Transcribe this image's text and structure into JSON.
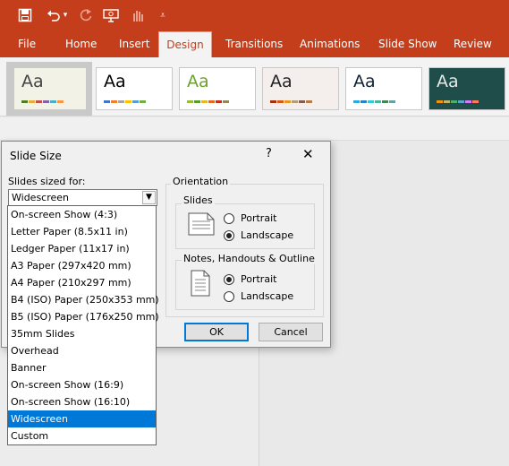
{
  "titlebar": {
    "icons": [
      "save-icon",
      "undo-icon",
      "undo-dropdown-icon",
      "redo-icon",
      "present-from-start-icon",
      "touch-mode-icon",
      "customize-qat-icon"
    ]
  },
  "ribbon_tabs": [
    "File",
    "Home",
    "Insert",
    "Design",
    "Transitions",
    "Animations",
    "Slide Show",
    "Review"
  ],
  "active_tab": "Design",
  "themes": [
    {
      "sample": "Aa",
      "bg": "#f2f2e6",
      "text": "#444",
      "stripe": [
        "#4f7a28",
        "#e3ad3d",
        "#c0504d",
        "#8064a2",
        "#4bacc6",
        "#f79646"
      ]
    },
    {
      "sample": "Aa",
      "bg": "#ffffff",
      "text": "#000",
      "stripe": [
        "#4472c4",
        "#ed7d31",
        "#a5a5a5",
        "#ffc000",
        "#5b9bd5",
        "#70ad47"
      ]
    },
    {
      "sample": "Aa",
      "bg": "#ffffff",
      "text": "#6ca12f",
      "stripe": [
        "#90c226",
        "#54a021",
        "#e6b91e",
        "#e76618",
        "#c42f1a",
        "#918655"
      ]
    },
    {
      "sample": "Aa",
      "bg": "#f4eeec",
      "text": "#222",
      "stripe": [
        "#a5300f",
        "#d55816",
        "#e19825",
        "#b19c7d",
        "#7f5f52",
        "#b27d49"
      ]
    },
    {
      "sample": "Aa",
      "bg": "#ffffff",
      "text": "#123",
      "stripe": [
        "#1cade4",
        "#2683c6",
        "#27ced7",
        "#42ba97",
        "#3e8853",
        "#62a39f"
      ]
    },
    {
      "sample": "Aa",
      "bg": "#1e4d4a",
      "text": "#e8e8e8",
      "stripe": [
        "#f09415",
        "#c1b56b",
        "#4baf73",
        "#5aa6c0",
        "#d17df9",
        "#fa7e5c"
      ]
    }
  ],
  "dialog": {
    "title": "Slide Size",
    "help_glyph": "?",
    "close_glyph": "✕",
    "sized_for_label": "Slides sized for:",
    "sized_for_value": "Widescreen",
    "orientation_label": "Orientation",
    "slides_group_label": "Slides",
    "notes_group_label": "Notes, Handouts & Outline",
    "portrait_label": "Portrait",
    "landscape_label": "Landscape",
    "slides_orientation": "Landscape",
    "notes_orientation": "Portrait",
    "ok_label": "OK",
    "cancel_label": "Cancel"
  },
  "dropdown": {
    "options": [
      "On-screen Show (4:3)",
      "Letter Paper (8.5x11 in)",
      "Ledger Paper (11x17 in)",
      "A3 Paper (297x420 mm)",
      "A4 Paper (210x297 mm)",
      "B4 (ISO) Paper (250x353 mm)",
      "B5 (ISO) Paper (176x250 mm)",
      "35mm Slides",
      "Overhead",
      "Banner",
      "On-screen Show (16:9)",
      "On-screen Show (16:10)",
      "Widescreen",
      "Custom"
    ],
    "selected": "Widescreen"
  },
  "colors": {
    "brand": "#c43e1c",
    "selection": "#0078d7",
    "dialog_bg": "#f0f0f0"
  }
}
